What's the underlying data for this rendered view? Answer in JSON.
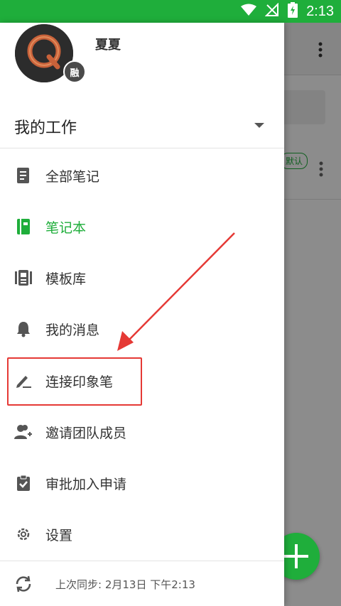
{
  "status_bar": {
    "time": "2:13",
    "bg_color": "#1fae3b",
    "icons": [
      "wifi-icon",
      "no-signal-icon",
      "battery-charging-icon"
    ]
  },
  "background_app": {
    "badge": "默认",
    "fab_icon": "plus-icon",
    "accent": "#1fae3b"
  },
  "drawer": {
    "user": {
      "name": "夏夏",
      "avatar_badge": "融"
    },
    "workspace": {
      "title": "我的工作",
      "dropdown_icon": "caret-down-icon"
    },
    "menu": [
      {
        "label": "全部笔记",
        "icon": "notes-icon",
        "active": false
      },
      {
        "label": "笔记本",
        "icon": "notebook-icon",
        "active": true
      },
      {
        "label": "模板库",
        "icon": "template-icon",
        "active": false
      },
      {
        "label": "我的消息",
        "icon": "bell-icon",
        "active": false
      },
      {
        "label": "连接印象笔",
        "icon": "pen-icon",
        "active": false
      },
      {
        "label": "邀请团队成员",
        "icon": "invite-team-icon",
        "active": false
      },
      {
        "label": "审批加入申请",
        "icon": "clipboard-check-icon",
        "active": false
      },
      {
        "label": "设置",
        "icon": "gear-icon",
        "active": false
      }
    ],
    "sync": {
      "text": "上次同步: 2月13日 下午2:13",
      "icon": "sync-icon"
    }
  },
  "colors": {
    "accent": "#1fae3b",
    "annotation": "#e53935",
    "text": "#333333"
  }
}
